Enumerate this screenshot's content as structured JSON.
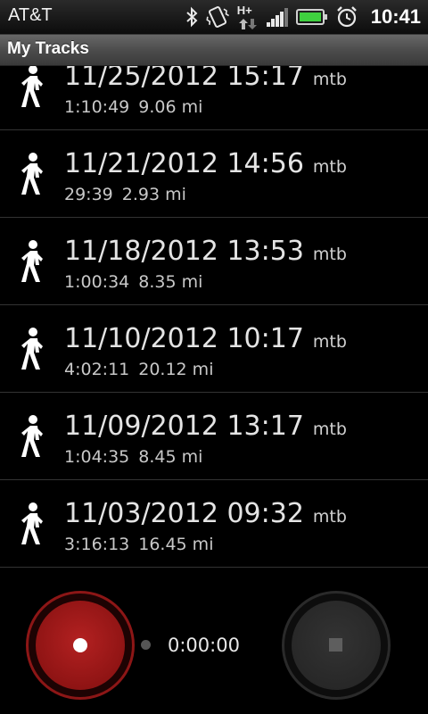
{
  "status_bar": {
    "carrier": "AT&T",
    "clock": "10:41",
    "network_label": "H+",
    "icons": [
      "bluetooth-icon",
      "vibrate-icon",
      "network-h-plus-icon",
      "signal-icon",
      "battery-icon",
      "alarm-icon"
    ]
  },
  "title_bar": {
    "title": "My Tracks"
  },
  "tracks": [
    {
      "date": "11/25/2012 15:17",
      "category": "mtb",
      "duration": "1:10:49",
      "distance": "9.06 mi",
      "icon": "walk-icon"
    },
    {
      "date": "11/21/2012 14:56",
      "category": "mtb",
      "duration": "29:39",
      "distance": "2.93 mi",
      "icon": "walk-icon"
    },
    {
      "date": "11/18/2012 13:53",
      "category": "mtb",
      "duration": "1:00:34",
      "distance": "8.35 mi",
      "icon": "walk-icon"
    },
    {
      "date": "11/10/2012 10:17",
      "category": "mtb",
      "duration": "4:02:11",
      "distance": "20.12 mi",
      "icon": "walk-icon"
    },
    {
      "date": "11/09/2012 13:17",
      "category": "mtb",
      "duration": "1:04:35",
      "distance": "8.45 mi",
      "icon": "walk-icon"
    },
    {
      "date": "11/03/2012 09:32",
      "category": "mtb",
      "duration": "3:16:13",
      "distance": "16.45 mi",
      "icon": "walk-icon"
    }
  ],
  "controls": {
    "elapsed_time": "0:00:00",
    "record_icon": "record-icon",
    "stop_icon": "stop-icon"
  },
  "colors": {
    "record_red": "#b32121",
    "record_ring": "#8c1616",
    "battery_green": "#3fd13f",
    "title_bar": "#4a4a4a"
  }
}
